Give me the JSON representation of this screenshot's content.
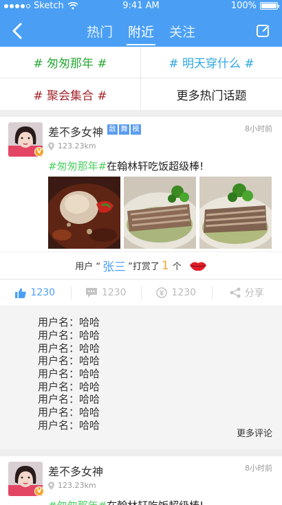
{
  "status_bar": {
    "carrier": "Sketch",
    "time": "9:41 AM",
    "battery": "100%"
  },
  "header": {
    "tabs": [
      {
        "label": "热门",
        "active": false
      },
      {
        "label": "附近",
        "active": true
      },
      {
        "label": "关注",
        "active": false
      }
    ],
    "back_icon": "chevron-left-icon",
    "edit_icon": "edit-icon",
    "color": "#4a9ff5"
  },
  "topics": [
    {
      "label": "# 匆匆那年 #",
      "color": "#2aa837"
    },
    {
      "label": "# 明天穿什么 #",
      "color": "#2ea7e0"
    },
    {
      "label": "# 聚会集合 #",
      "color": "#a3262c"
    },
    {
      "label": "更多热门话题",
      "color": "#222222"
    }
  ],
  "posts": [
    {
      "author": "差不多女神",
      "tags": [
        "敌",
        "舞",
        "模"
      ],
      "time": "8小时前",
      "distance": "123.23km",
      "hashtag": "#匆匆那年#",
      "text": "在翰林轩吃饭超级棒!",
      "reward": {
        "prefix": "用户 “",
        "user": "张三",
        "middle": "”打赏了",
        "count": "1",
        "unit": "个"
      },
      "actions": {
        "likes": "1230",
        "comments": "1230",
        "coins": "1230",
        "share": "分享"
      },
      "comments": [
        "用户名：哈哈",
        "用户名：哈哈",
        "用户名：哈哈",
        "用户名：哈哈",
        "用户名：哈哈",
        "用户名：哈哈",
        "用户名：哈哈",
        "用户名：哈哈",
        "用户名：哈哈"
      ],
      "more_comments": "更多评论"
    },
    {
      "author": "差不多女神",
      "time": "8小时前",
      "distance": "123.23km",
      "hashtag": "#匆匆那年#",
      "text": "在翰林轩吃饭超级棒!"
    }
  ]
}
